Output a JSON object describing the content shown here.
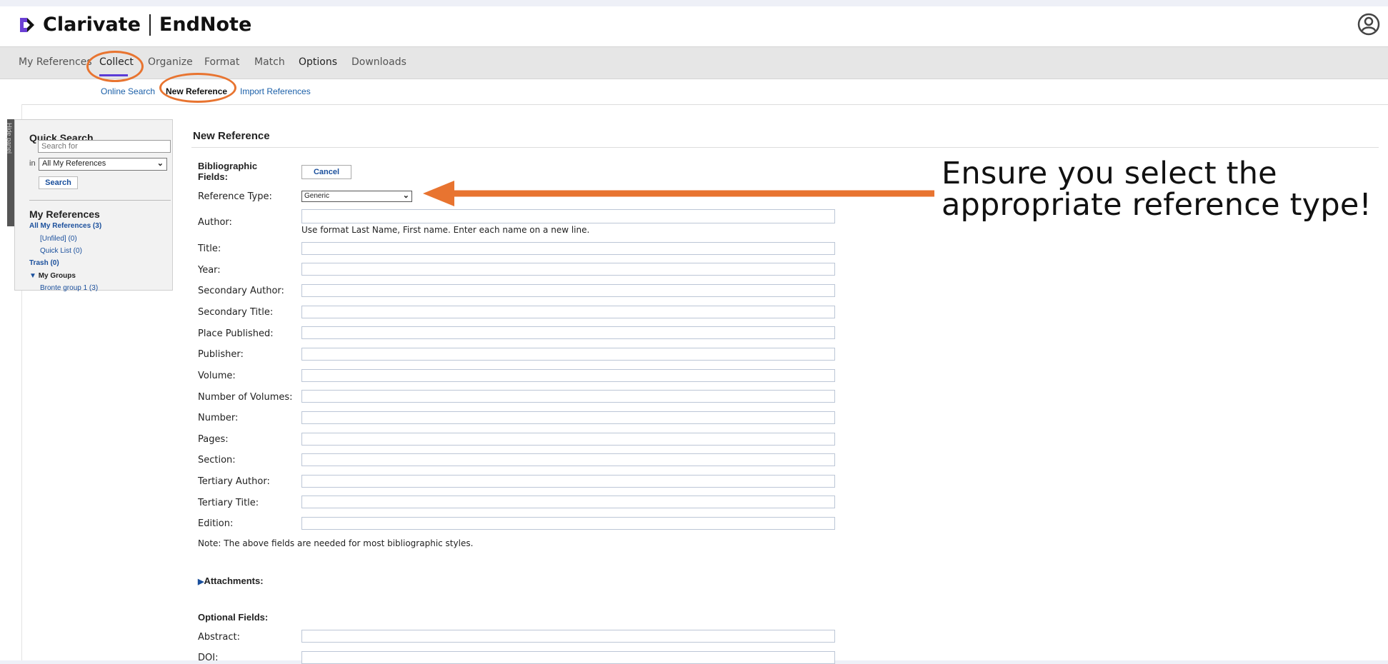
{
  "header": {
    "brand_left": "Clarivate",
    "brand_right": "EndNote",
    "user_icon": "user-circle-icon"
  },
  "nav": {
    "items": [
      {
        "label": "My References"
      },
      {
        "label": "Collect"
      },
      {
        "label": "Organize"
      },
      {
        "label": "Format"
      },
      {
        "label": "Match"
      },
      {
        "label": "Options"
      },
      {
        "label": "Downloads"
      }
    ],
    "active": "Collect"
  },
  "subnav": {
    "items": [
      {
        "label": "Online Search"
      },
      {
        "label": "New Reference"
      },
      {
        "label": "Import References"
      }
    ],
    "active": "New Reference"
  },
  "hide_panel": {
    "label": "Hide panel"
  },
  "sidebar": {
    "quick_search_title": "Quick Search",
    "search_placeholder": "Search for",
    "in_label": "in",
    "scope_value": "All My References",
    "search_button": "Search",
    "my_references_title": "My References",
    "links": [
      {
        "label": "All My References (3)"
      },
      {
        "label": "[Unfiled] (0)"
      },
      {
        "label": "Quick List (0)"
      },
      {
        "label": "Trash (0)"
      },
      {
        "label": "My Groups"
      },
      {
        "label": "Bronte group 1 (3)"
      }
    ]
  },
  "form": {
    "title": "New Reference",
    "bibliographic_label": "Bibliographic Fields:",
    "cancel_button": "Cancel",
    "reference_type_label": "Reference Type:",
    "reference_type_value": "Generic",
    "author_hint": "Use format Last Name, First name. Enter each name on a new line.",
    "fields": [
      {
        "label": "Author:"
      },
      {
        "label": "Title:"
      },
      {
        "label": "Year:"
      },
      {
        "label": "Secondary Author:"
      },
      {
        "label": "Secondary Title:"
      },
      {
        "label": "Place Published:"
      },
      {
        "label": "Publisher:"
      },
      {
        "label": "Volume:"
      },
      {
        "label": "Number of Volumes:"
      },
      {
        "label": "Number:"
      },
      {
        "label": "Pages:"
      },
      {
        "label": "Section:"
      },
      {
        "label": "Tertiary Author:"
      },
      {
        "label": "Tertiary Title:"
      },
      {
        "label": "Edition:"
      }
    ],
    "note": "Note: The above fields are needed for most bibliographic styles.",
    "attachments_label": "Attachments:",
    "optional_label": "Optional Fields:",
    "optional_fields": [
      {
        "label": "Abstract:"
      },
      {
        "label": "DOI:"
      }
    ]
  },
  "annotation": {
    "line1": "Ensure you select the",
    "line2": "appropriate reference type!",
    "color": "#e87430"
  }
}
